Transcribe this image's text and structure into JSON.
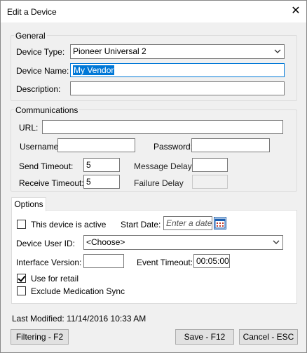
{
  "window": {
    "title": "Edit a Device",
    "close_glyph": "✕"
  },
  "general": {
    "legend": "General",
    "device_type_label": "Device Type:",
    "device_type_value": "Pioneer Universal 2",
    "device_name_label": "Device Name:",
    "device_name_value": "My Vendor",
    "description_label": "Description:",
    "description_value": ""
  },
  "communications": {
    "legend": "Communications",
    "url_label": "URL:",
    "url_value": "",
    "username_label": "Username:",
    "username_value": "",
    "password_label": "Password:",
    "password_value": "",
    "send_timeout_label": "Send Timeout:",
    "send_timeout_value": "5",
    "receive_timeout_label": "Receive Timeout:",
    "receive_timeout_value": "5",
    "message_delay_label": "Message Delay",
    "message_delay_value": "",
    "failure_delay_label": "Failure Delay",
    "failure_delay_value": ""
  },
  "options": {
    "tab_label": "Options",
    "device_active_label": "This device is active",
    "device_active_checked": false,
    "start_date_label": "Start Date:",
    "start_date_placeholder": "Enter a date",
    "device_user_id_label": "Device User ID:",
    "device_user_id_value": "<Choose>",
    "interface_version_label": "Interface Version:",
    "interface_version_value": "",
    "event_timeout_label": "Event Timeout:",
    "event_timeout_value": "00:05:00",
    "use_for_retail_label": "Use for retail",
    "use_for_retail_checked": true,
    "exclude_med_sync_label": "Exclude Medication Sync",
    "exclude_med_sync_checked": false
  },
  "footer": {
    "last_modified": "Last Modified: 11/14/2016 10:33 AM",
    "filtering_button": "Filtering - F2",
    "save_button": "Save - F12",
    "cancel_button": "Cancel - ESC"
  },
  "colors": {
    "accent": "#0078d7",
    "background": "#f0f0f0"
  },
  "icons": {
    "close": "close-icon",
    "dropdown": "chevron-down-icon",
    "calendar": "calendar-icon"
  }
}
